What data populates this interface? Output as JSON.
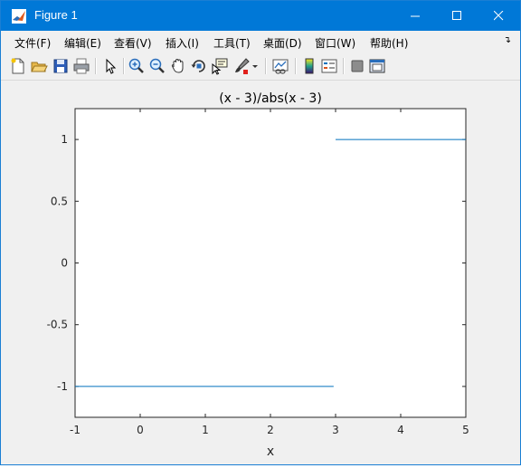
{
  "window": {
    "title": "Figure 1"
  },
  "titlebar_buttons": [
    "minimize-icon",
    "maximize-icon",
    "close-icon"
  ],
  "menu": {
    "items": [
      {
        "label": "文件(F)"
      },
      {
        "label": "编辑(E)"
      },
      {
        "label": "查看(V)"
      },
      {
        "label": "插入(I)"
      },
      {
        "label": "工具(T)"
      },
      {
        "label": "桌面(D)"
      },
      {
        "label": "窗口(W)"
      },
      {
        "label": "帮助(H)"
      }
    ],
    "overflow_icon": "dock-arrow-icon"
  },
  "toolbar": {
    "icons": [
      "new-figure-icon",
      "open-file-icon",
      "save-icon",
      "print-icon",
      "edit-plot-pointer-icon",
      "zoom-in-icon",
      "zoom-out-icon",
      "pan-hand-icon",
      "rotate-3d-icon",
      "data-cursor-icon",
      "brush-icon",
      "brush-dropdown-icon",
      "link-plot-icon",
      "colorbar-icon",
      "legend-icon",
      "hide-plot-tools-icon",
      "show-plot-tools-icon"
    ]
  },
  "colors": {
    "titlebar": "#0078d7",
    "line": "#0072bd",
    "background": "#f0f0f0"
  },
  "chart_data": {
    "type": "line",
    "title": "(x - 3)/abs(x - 3)",
    "xlabel": "x",
    "ylabel": "",
    "xlim": [
      -1,
      5
    ],
    "ylim": [
      -1.25,
      1.25
    ],
    "xticks": [
      "-1",
      "0",
      "1",
      "2",
      "3",
      "4",
      "5"
    ],
    "yticks": [
      "-1",
      "-0.5",
      "0",
      "0.5",
      "1"
    ],
    "grid": false,
    "series": [
      {
        "x": [
          -1,
          2.97
        ],
        "y": [
          -1,
          -1
        ]
      },
      {
        "x": [
          3.0,
          5
        ],
        "y": [
          1,
          1
        ]
      }
    ]
  }
}
